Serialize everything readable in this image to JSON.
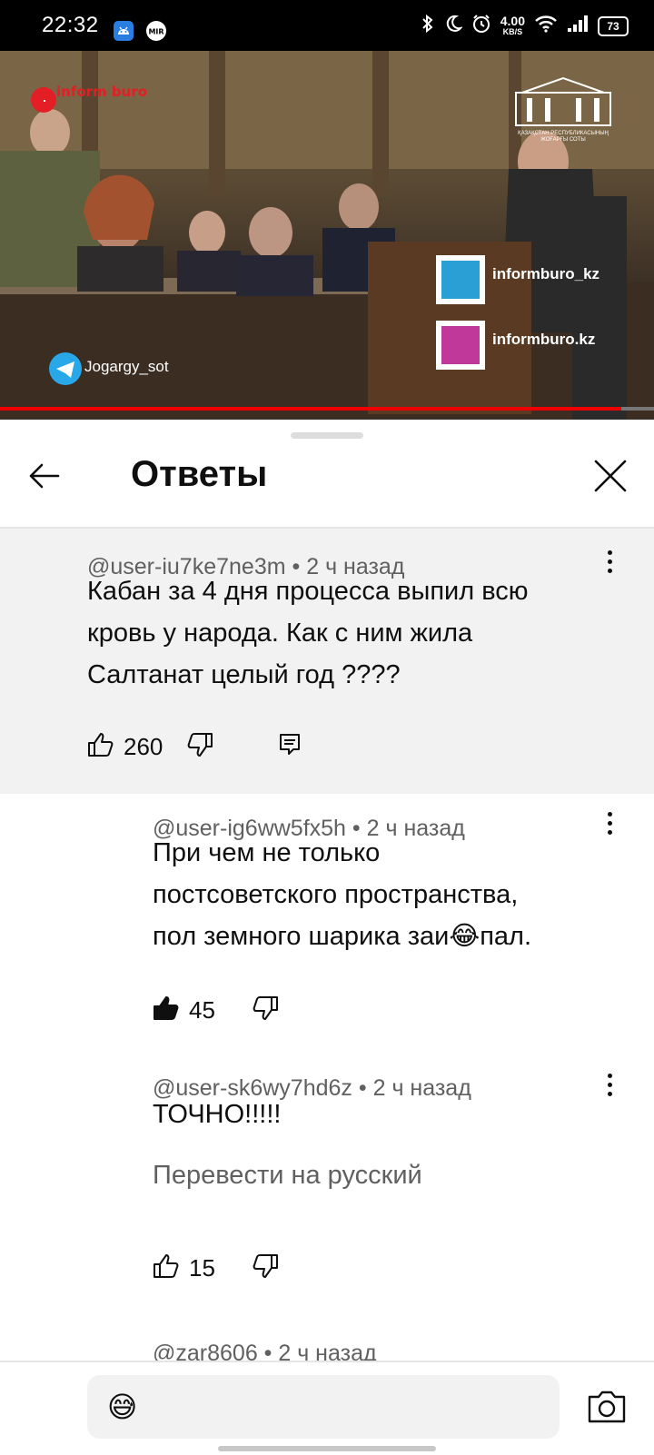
{
  "status_bar": {
    "time": "22:32",
    "net_speed_value": "4.00",
    "net_speed_unit": "KB/S",
    "battery": "73",
    "icons": [
      "android-icon",
      "mir-icon",
      "bluetooth-icon",
      "moon-icon",
      "alarm-icon",
      "wifi-icon",
      "signal-icon",
      "battery-icon"
    ],
    "mir_label": "MIR"
  },
  "video": {
    "progress_fraction": 0.95,
    "watermark_logo": "inform buro",
    "telegram_handle": "Jogargy_sot",
    "qr_label_1": "informburo_kz",
    "qr_label_2": "informburo.kz",
    "court_emblem": "ҚАЗАҚСТАН РЕСПУБЛИКАСЫНЫҢ ЖОҒАРҒЫ СОТЫ"
  },
  "sheet": {
    "title": "Ответы",
    "back_icon": "arrow-left-icon",
    "close_icon": "close-icon"
  },
  "comments": [
    {
      "author": "@user-iu7ke7ne3m",
      "time": "2 ч назад",
      "lines": [
        "Кабан за 4 дня процесса выпил всю",
        "кровь у народа. Как с ним жила",
        "Салтанат целый год ????"
      ],
      "likes": "260",
      "highlighted": true
    },
    {
      "author": "@user-ig6ww5fx5h",
      "time": "2 ч назад",
      "lines": [
        "При чем не только",
        "постсоветского пространства,",
        "пол земного шарика заи😂пал."
      ],
      "likes": "45",
      "liked": true
    },
    {
      "author": "@user-sk6wy7hd6z",
      "time": "2 ч назад",
      "lines": [
        "ТОЧНО!!!!!"
      ],
      "translate": "Перевести на русский",
      "likes": "15"
    },
    {
      "author_partial": "@zar8606 • 2 ч назад"
    }
  ],
  "composer": {
    "emoji": "😅",
    "camera_icon": "camera-icon"
  },
  "separator": "•"
}
